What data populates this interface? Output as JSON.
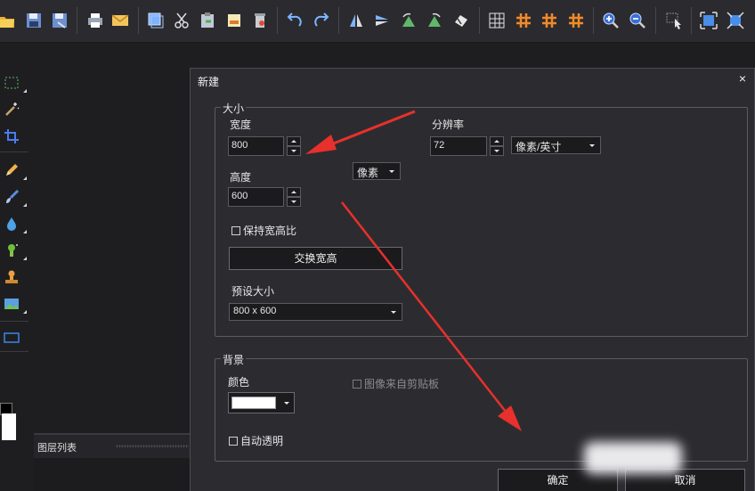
{
  "toolbar": {
    "buttons": [
      "open-folder-icon",
      "save-icon",
      "save-as-icon",
      "print-icon",
      "email-icon",
      "copy-layer-icon",
      "cut-icon",
      "paste-icon",
      "paste-new-icon",
      "clear-icon",
      "undo-icon",
      "redo-icon",
      "flip-vertical-icon",
      "flip-horizontal-icon",
      "rotate-left-icon",
      "rotate-right-icon",
      "rotate-free-icon",
      "grid-icon",
      "hash-grid-icon",
      "hash-grid-2-icon",
      "hash-grid-3-icon",
      "zoom-in-icon",
      "zoom-out-icon",
      "pointer-icon",
      "fit-window-icon",
      "actual-size-icon"
    ]
  },
  "left_tools": [
    "marquee-icon",
    "magic-wand-icon",
    "crop-icon",
    "pencil-icon",
    "brush-icon",
    "drop-icon",
    "spray-icon",
    "stamp-icon",
    "image-icon",
    "rectangle-icon"
  ],
  "layer_panel": {
    "title": "图层列表"
  },
  "dialog": {
    "title": "新建",
    "size_group": {
      "legend": "大小",
      "width_label": "宽度",
      "width_value": "800",
      "height_label": "高度",
      "height_value": "600",
      "unit_select": "像素",
      "resolution_label": "分辨率",
      "resolution_value": "72",
      "resolution_unit": "像素/英寸",
      "keep_ratio_label": "保持宽高比",
      "keep_ratio_checked": false,
      "swap_button": "交换宽高",
      "preset_label": "预设大小",
      "preset_value": "800 x 600"
    },
    "background_group": {
      "legend": "背景",
      "color_label": "颜色",
      "color_value": "#ffffff",
      "clipboard_label": "图像来自剪贴板",
      "clipboard_checked": false,
      "auto_transparent_label": "自动透明",
      "auto_transparent_checked": false
    },
    "ok_button": "确定",
    "cancel_button": "取消",
    "close_glyph": "×"
  },
  "colors": {
    "annotation_arrow": "#e8302c",
    "dialog_bg": "#2c2c30",
    "app_bg": "#1e1e21"
  }
}
